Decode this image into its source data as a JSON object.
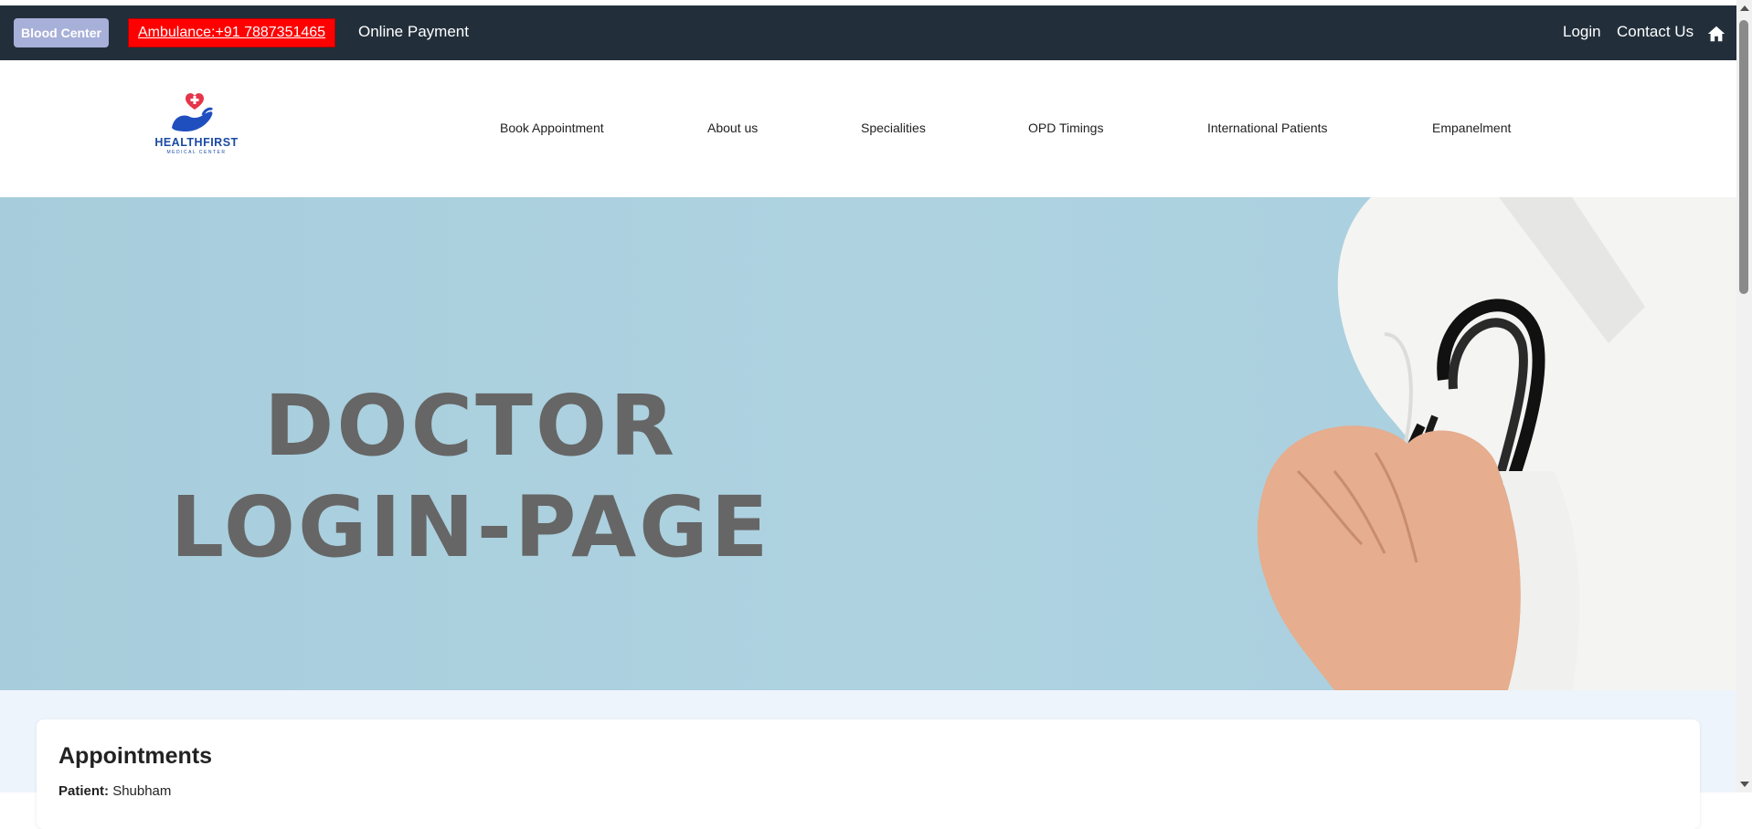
{
  "topbar": {
    "blood_center_label": "Blood Center",
    "ambulance_label": "Ambulance:+91 7887351465",
    "online_payment_label": "Online Payment",
    "login_label": "Login",
    "contact_label": "Contact Us",
    "home_icon": "home-icon"
  },
  "logo": {
    "name": "HEALTHFIRST",
    "subtitle": "MEDICAL CENTER"
  },
  "nav": {
    "items": [
      {
        "label": "Book Appointment"
      },
      {
        "label": "About us"
      },
      {
        "label": "Specialities"
      },
      {
        "label": "OPD Timings"
      },
      {
        "label": "International Patients"
      },
      {
        "label": "Empanelment"
      }
    ]
  },
  "hero": {
    "line1": "DOCTOR",
    "line2": "LOGIN-PAGE"
  },
  "appointments": {
    "title": "Appointments",
    "patient_label": "Patient:",
    "patient_value": "Shubham"
  },
  "colors": {
    "topbar": "#222f3b",
    "ambulance": "#ff0000",
    "hero_bg": "#aed2e0",
    "hero_text": "#666666",
    "logo_blue": "#1a4aa3",
    "logo_red": "#e5354a"
  }
}
